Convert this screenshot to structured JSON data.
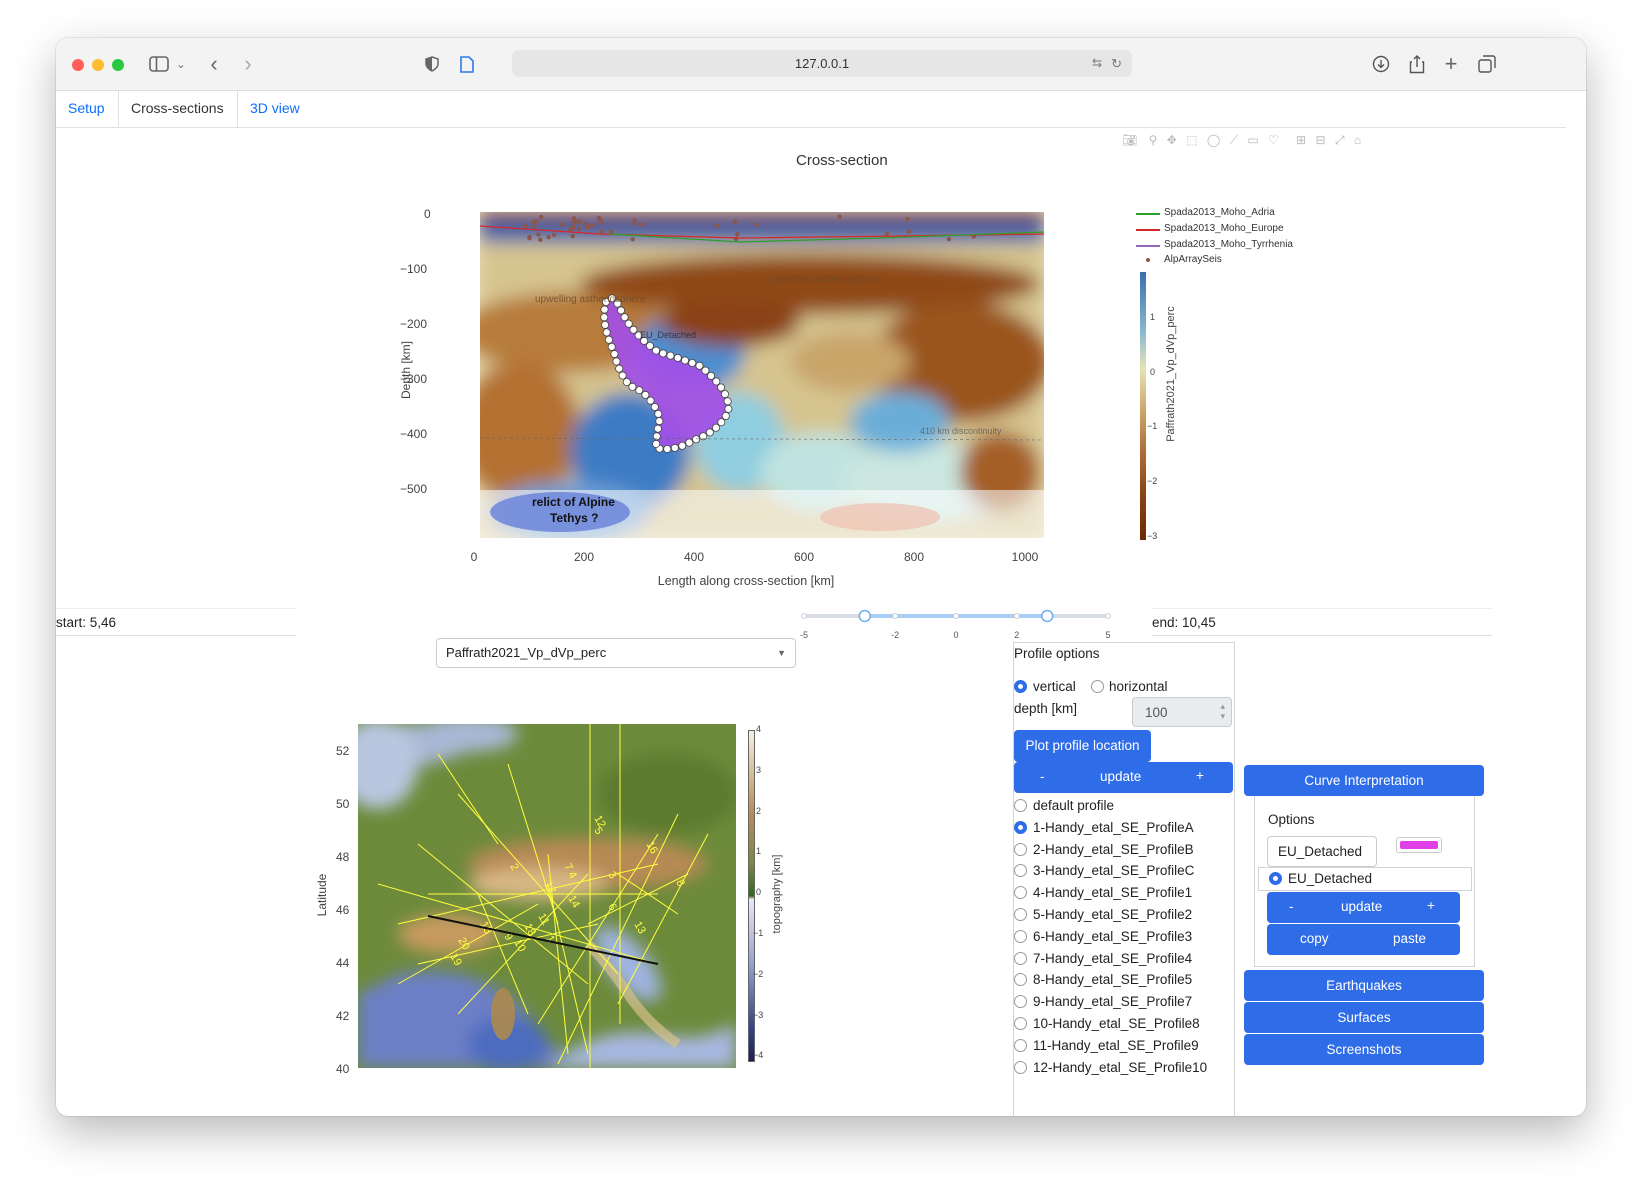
{
  "browser": {
    "url": "127.0.0.1"
  },
  "tabs": [
    {
      "label": "Setup",
      "active": false
    },
    {
      "label": "Cross-sections",
      "active": true
    },
    {
      "label": "3D view",
      "active": false
    }
  ],
  "cross_section": {
    "title": "Cross-section",
    "xlabel": "Length along cross-section [km]",
    "ylabel": "Depth [km]",
    "xticks": [
      "0",
      "200",
      "400",
      "600",
      "800",
      "1000"
    ],
    "yticks": [
      "0",
      "−100",
      "−200",
      "−300",
      "−400",
      "−500"
    ],
    "annotations": [
      "relict of Alpine",
      "Tethys ?"
    ],
    "overlay_labels": [
      "EU_Detached",
      "upwelling asthenosphere",
      "upwelling asthenosphere",
      "410 km discontinuity"
    ],
    "legend": [
      {
        "name": "Spada2013_Moho_Adria",
        "color": "#2ca02c"
      },
      {
        "name": "Spada2013_Moho_Europe",
        "color": "#d62728"
      },
      {
        "name": "Spada2013_Moho_Tyrrhenia",
        "color": "#9467bd"
      },
      {
        "name": "AlpArraySeis",
        "color": "#8c564b"
      }
    ],
    "colorbar": {
      "title": "Paffrath2021_Vp_dVp_perc",
      "ticks": [
        "1",
        "0",
        "−1",
        "−2",
        "−3"
      ]
    }
  },
  "controls": {
    "start": "start: 5,46",
    "end": "end: 10,45",
    "dataset": "Paffrath2021_Vp_dVp_perc",
    "slider_ticks": [
      "-5",
      "-2",
      "0",
      "2",
      "5"
    ],
    "slider_range": [
      -3,
      3
    ]
  },
  "map": {
    "ylabel": "Latitude",
    "yticks": [
      "52",
      "50",
      "48",
      "46",
      "44",
      "42",
      "40"
    ],
    "colorbar_title": "topography [km]",
    "colorbar_ticks": [
      "4",
      "3",
      "2",
      "1",
      "0",
      "−1",
      "−2",
      "−3",
      "−4"
    ],
    "profile_labels": [
      "12",
      "5",
      "16",
      "2",
      "17",
      "4",
      "3",
      "8",
      "14",
      "6",
      "13",
      "15",
      "18",
      "9",
      "10",
      "1",
      "20",
      "19",
      "11",
      "7"
    ]
  },
  "profile_options": {
    "title": "Profile options",
    "orientation": [
      {
        "label": "vertical",
        "checked": true
      },
      {
        "label": "horizontal",
        "checked": false
      }
    ],
    "depth_label": "depth [km]",
    "depth_value": "100",
    "plot_button": "Plot profile location",
    "update_minus": "-",
    "update_label": "update",
    "update_plus": "+",
    "profiles": [
      {
        "label": "default profile",
        "checked": false
      },
      {
        "label": "1-Handy_etal_SE_ProfileA",
        "checked": true
      },
      {
        "label": "2-Handy_etal_SE_ProfileB",
        "checked": false
      },
      {
        "label": "3-Handy_etal_SE_ProfileC",
        "checked": false
      },
      {
        "label": "4-Handy_etal_SE_Profile1",
        "checked": false
      },
      {
        "label": "5-Handy_etal_SE_Profile2",
        "checked": false
      },
      {
        "label": "6-Handy_etal_SE_Profile3",
        "checked": false
      },
      {
        "label": "7-Handy_etal_SE_Profile4",
        "checked": false
      },
      {
        "label": "8-Handy_etal_SE_Profile5",
        "checked": false
      },
      {
        "label": "9-Handy_etal_SE_Profile7",
        "checked": false
      },
      {
        "label": "10-Handy_etal_SE_Profile8",
        "checked": false
      },
      {
        "label": "11-Handy_etal_SE_Profile9",
        "checked": false
      },
      {
        "label": "12-Handy_etal_SE_Profile10",
        "checked": false
      }
    ]
  },
  "curve": {
    "button": "Curve Interpretation",
    "options_title": "Options",
    "name_value": "EU_Detached",
    "swatch_color": "#e040e6",
    "item_label": "EU_Detached",
    "update_minus": "-",
    "update_label": "update",
    "update_plus": "+",
    "copy_label": "copy",
    "paste_label": "paste"
  },
  "side_buttons": [
    "Earthquakes",
    "Surfaces",
    "Screenshots"
  ]
}
